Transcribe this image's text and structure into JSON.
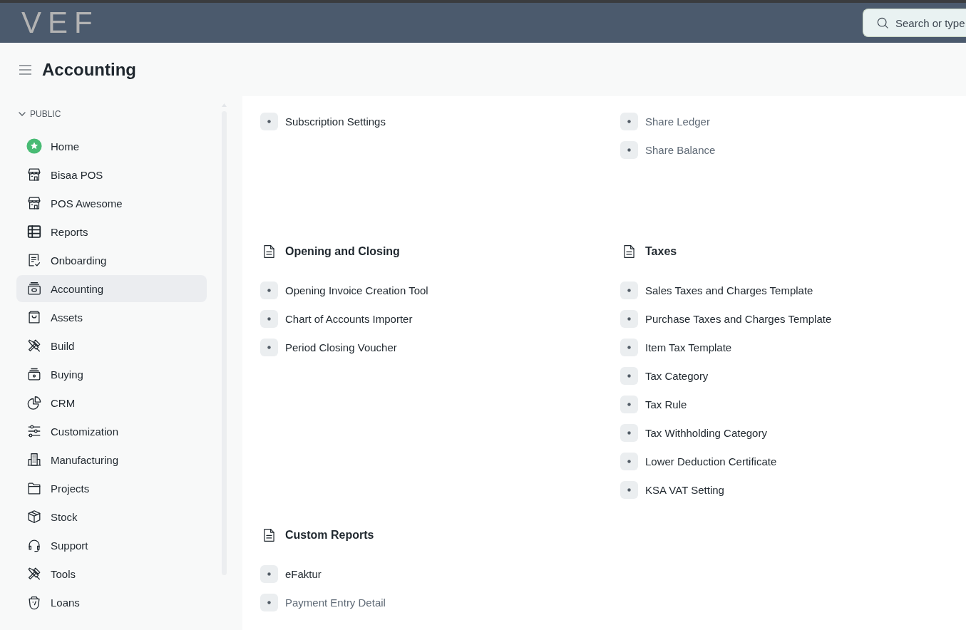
{
  "navbar": {
    "logo": "VEF",
    "search": {
      "placeholder": "Search or type"
    }
  },
  "page": {
    "title": "Accounting"
  },
  "sidebar": {
    "section": {
      "label": "PUBLIC",
      "expanded": true
    },
    "items": [
      {
        "label": "Home",
        "selected": false
      },
      {
        "label": "Bisaa POS",
        "selected": false
      },
      {
        "label": "POS Awesome",
        "selected": false
      },
      {
        "label": "Reports",
        "selected": false
      },
      {
        "label": "Onboarding",
        "selected": false
      },
      {
        "label": "Accounting",
        "selected": true
      },
      {
        "label": "Assets",
        "selected": false
      },
      {
        "label": "Build",
        "selected": false
      },
      {
        "label": "Buying",
        "selected": false
      },
      {
        "label": "CRM",
        "selected": false
      },
      {
        "label": "Customization",
        "selected": false
      },
      {
        "label": "Manufacturing",
        "selected": false
      },
      {
        "label": "Projects",
        "selected": false
      },
      {
        "label": "Stock",
        "selected": false
      },
      {
        "label": "Support",
        "selected": false
      },
      {
        "label": "Tools",
        "selected": false
      },
      {
        "label": "Loans",
        "selected": false
      }
    ]
  },
  "content": {
    "rows": [
      {
        "cards": [
          {
            "links": [
              {
                "label": "Subscription Settings",
                "dimmed": false
              }
            ]
          },
          {
            "links": [
              {
                "label": "Share Ledger",
                "dimmed": true
              },
              {
                "label": "Share Balance",
                "dimmed": true
              }
            ]
          }
        ]
      },
      {
        "cards": [
          {
            "title": "Opening and Closing",
            "links": [
              {
                "label": "Opening Invoice Creation Tool",
                "dimmed": false
              },
              {
                "label": "Chart of Accounts Importer",
                "dimmed": false
              },
              {
                "label": "Period Closing Voucher",
                "dimmed": false
              }
            ]
          },
          {
            "title": "Taxes",
            "links": [
              {
                "label": "Sales Taxes and Charges Template",
                "dimmed": false
              },
              {
                "label": "Purchase Taxes and Charges Template",
                "dimmed": false
              },
              {
                "label": "Item Tax Template",
                "dimmed": false
              },
              {
                "label": "Tax Category",
                "dimmed": false
              },
              {
                "label": "Tax Rule",
                "dimmed": false
              },
              {
                "label": "Tax Withholding Category",
                "dimmed": false
              },
              {
                "label": "Lower Deduction Certificate",
                "dimmed": false
              },
              {
                "label": "KSA VAT Setting",
                "dimmed": false
              }
            ]
          }
        ]
      },
      {
        "cards": [
          {
            "title": "Custom Reports",
            "links": [
              {
                "label": "eFaktur",
                "dimmed": false
              },
              {
                "label": "Payment Entry Detail",
                "dimmed": true
              }
            ]
          }
        ]
      }
    ]
  }
}
